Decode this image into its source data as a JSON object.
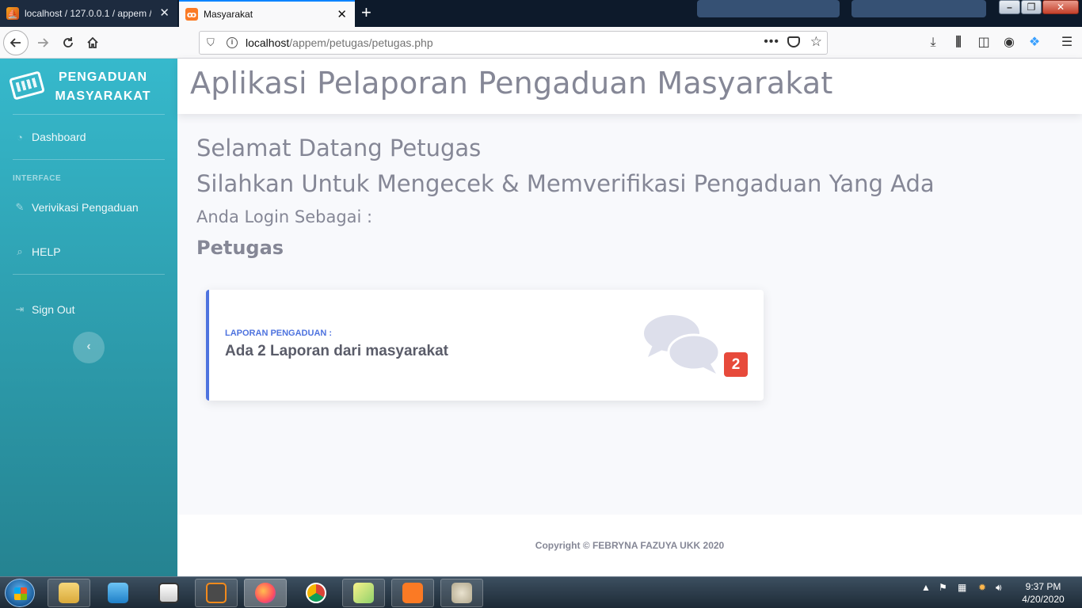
{
  "browser": {
    "tabs": [
      {
        "title": "localhost / 127.0.0.1 / appem / ",
        "active": false
      },
      {
        "title": "Masyarakat",
        "active": true
      }
    ],
    "url_host": "localhost",
    "url_path": "/appem/petugas/petugas.php",
    "icons": [
      "back-icon",
      "forward-icon",
      "reload-icon",
      "home-icon",
      "downloads-icon",
      "library-icon",
      "sidebar-icon",
      "account-icon",
      "sync-icon",
      "menu-icon"
    ]
  },
  "sidebar": {
    "brand_line1": "PENGADUAN",
    "brand_line2": "MASYARAKAT",
    "items": [
      {
        "label": "Dashboard",
        "icon": "tachometer-icon"
      },
      {
        "label": "Verivikasi Pengaduan",
        "icon": "edit-icon"
      },
      {
        "label": "HELP",
        "icon": "search-icon"
      },
      {
        "label": "Sign Out",
        "icon": "sign-out-icon"
      }
    ],
    "heading": "INTERFACE"
  },
  "header": {
    "title": "Aplikasi Pelaporan Pengaduan Masyarakat"
  },
  "main": {
    "welcome": "Selamat Datang Petugas",
    "instruction": "Silahkan Untuk Mengecek & Memverifikasi Pengaduan Yang Ada",
    "login_as_label": "Anda Login Sebagai :",
    "role": "Petugas",
    "card": {
      "label": "LAPORAN PENGADUAN :",
      "value": "Ada 2 Laporan dari masyarakat",
      "badge": "2",
      "accent": "#4e73df",
      "badge_color": "#e74a3b"
    }
  },
  "footer": {
    "copyright": "Copyright © FEBRYNA FAZUYA UKK 2020"
  },
  "taskbar": {
    "time": "9:37 PM",
    "date": "4/20/2020"
  },
  "colors": {
    "sidebar_top": "#36b9cc",
    "sidebar_bottom": "#258391",
    "text_gray": "#858796"
  }
}
